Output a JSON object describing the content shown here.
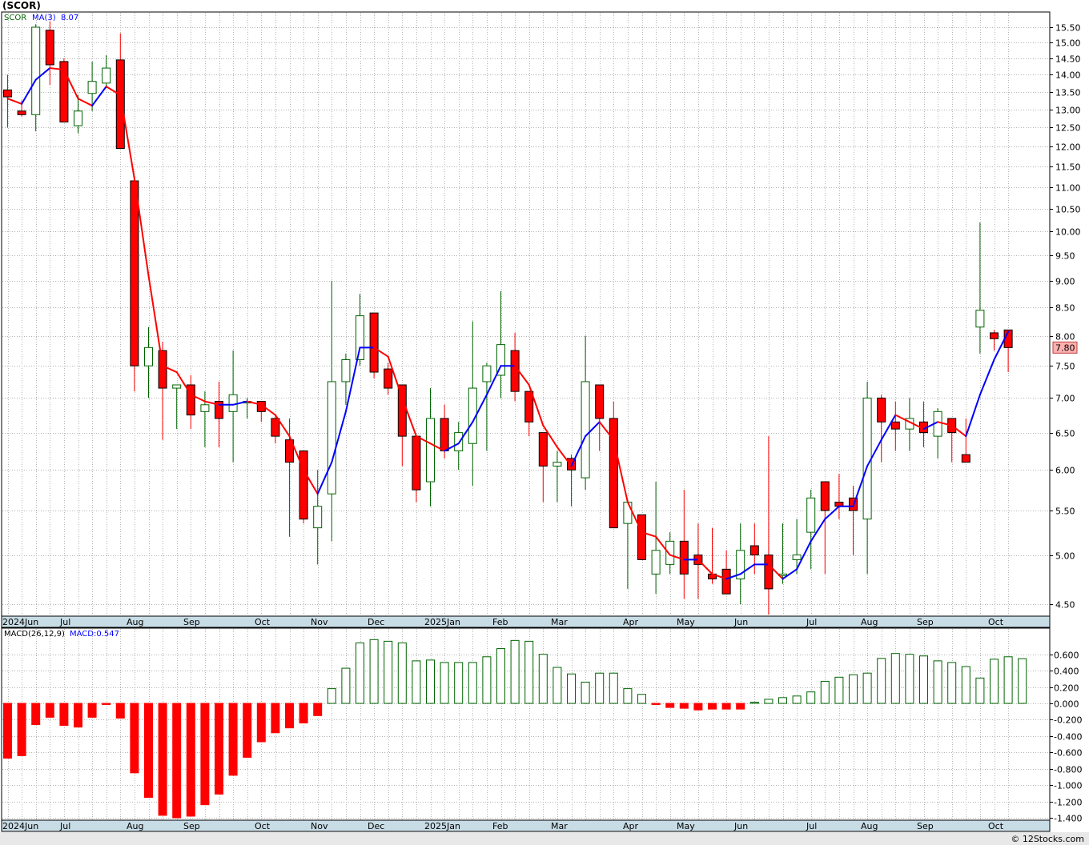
{
  "symbol_label": "(SCOR)",
  "credit": "© 12Stocks.com",
  "colors": {
    "up": "#006400",
    "down": "#ff0000",
    "ma_up": "#0000ff",
    "ma_down": "#ff0000",
    "macd_up": "#006400",
    "macd_down": "#ff0000",
    "price_tag_bg": "#ffb0b0"
  },
  "chart_data": [
    {
      "type": "candlestick",
      "legend": {
        "symbol": "SCOR",
        "ma_label": "MA(3)",
        "ma_value": "8.07"
      },
      "y_ticks": [
        "15.50",
        "15.00",
        "14.50",
        "14.00",
        "13.50",
        "13.00",
        "12.50",
        "12.00",
        "11.50",
        "11.00",
        "10.50",
        "10.00",
        "9.50",
        "9.00",
        "8.50",
        "8.00",
        "7.50",
        "7.00",
        "6.50",
        "6.00",
        "5.50",
        "5.00",
        "4.50"
      ],
      "y_scale": "log",
      "last_price_label": "7.80",
      "x_labels": [
        "2024Jun",
        "Jul",
        "Aug",
        "Sep",
        "Oct",
        "Nov",
        "Dec",
        "2025Jan",
        "Feb",
        "Mar",
        "Apr",
        "May",
        "Jun",
        "Jul",
        "Aug",
        "Sep",
        "Oct"
      ],
      "candles": [
        {
          "o": 13.55,
          "h": 14.0,
          "l": 12.5,
          "c": 13.35
        },
        {
          "o": 12.95,
          "h": 13.25,
          "l": 12.8,
          "c": 12.85
        },
        {
          "o": 12.85,
          "h": 15.6,
          "l": 12.4,
          "c": 15.5
        },
        {
          "o": 15.4,
          "h": 15.7,
          "l": 13.7,
          "c": 14.3
        },
        {
          "o": 14.4,
          "h": 14.5,
          "l": 12.7,
          "c": 12.65
        },
        {
          "o": 12.55,
          "h": 13.4,
          "l": 12.35,
          "c": 12.95
        },
        {
          "o": 13.45,
          "h": 14.4,
          "l": 12.95,
          "c": 13.8
        },
        {
          "o": 13.75,
          "h": 14.6,
          "l": 13.6,
          "c": 14.2
        },
        {
          "o": 14.45,
          "h": 15.3,
          "l": 12.0,
          "c": 11.95
        },
        {
          "o": 11.15,
          "h": 11.2,
          "l": 7.1,
          "c": 7.5
        },
        {
          "o": 7.5,
          "h": 8.15,
          "l": 7.0,
          "c": 7.8
        },
        {
          "o": 7.75,
          "h": 7.9,
          "l": 6.4,
          "c": 7.15
        },
        {
          "o": 7.15,
          "h": 7.2,
          "l": 6.55,
          "c": 7.2
        },
        {
          "o": 7.2,
          "h": 7.35,
          "l": 6.55,
          "c": 6.75
        },
        {
          "o": 6.8,
          "h": 7.1,
          "l": 6.3,
          "c": 6.9
        },
        {
          "o": 6.95,
          "h": 7.25,
          "l": 6.3,
          "c": 6.7
        },
        {
          "o": 6.8,
          "h": 7.75,
          "l": 6.1,
          "c": 7.05
        },
        {
          "o": 6.95,
          "h": 7.0,
          "l": 6.7,
          "c": 6.95
        },
        {
          "o": 6.95,
          "h": 6.95,
          "l": 6.65,
          "c": 6.8
        },
        {
          "o": 6.7,
          "h": 6.75,
          "l": 6.35,
          "c": 6.45
        },
        {
          "o": 6.4,
          "h": 6.7,
          "l": 5.2,
          "c": 6.1
        },
        {
          "o": 6.25,
          "h": 6.25,
          "l": 5.35,
          "c": 5.4
        },
        {
          "o": 5.3,
          "h": 6.0,
          "l": 4.9,
          "c": 5.55
        },
        {
          "o": 5.7,
          "h": 9.0,
          "l": 5.15,
          "c": 7.25
        },
        {
          "o": 7.25,
          "h": 7.7,
          "l": 6.9,
          "c": 7.6
        },
        {
          "o": 7.6,
          "h": 8.75,
          "l": 7.5,
          "c": 8.35
        },
        {
          "o": 8.4,
          "h": 8.4,
          "l": 7.3,
          "c": 7.4
        },
        {
          "o": 7.45,
          "h": 7.55,
          "l": 7.05,
          "c": 7.15
        },
        {
          "o": 7.2,
          "h": 7.2,
          "l": 6.05,
          "c": 6.45
        },
        {
          "o": 6.45,
          "h": 6.45,
          "l": 5.6,
          "c": 5.75
        },
        {
          "o": 5.85,
          "h": 7.15,
          "l": 5.55,
          "c": 6.7
        },
        {
          "o": 6.7,
          "h": 6.9,
          "l": 6.15,
          "c": 6.25
        },
        {
          "o": 6.25,
          "h": 6.65,
          "l": 6.0,
          "c": 6.5
        },
        {
          "o": 6.35,
          "h": 8.25,
          "l": 5.8,
          "c": 7.15
        },
        {
          "o": 7.25,
          "h": 7.55,
          "l": 6.25,
          "c": 7.5
        },
        {
          "o": 7.35,
          "h": 8.8,
          "l": 7.0,
          "c": 7.85
        },
        {
          "o": 7.75,
          "h": 8.05,
          "l": 6.95,
          "c": 7.1
        },
        {
          "o": 7.1,
          "h": 7.1,
          "l": 6.45,
          "c": 6.65
        },
        {
          "o": 6.5,
          "h": 6.5,
          "l": 5.6,
          "c": 6.05
        },
        {
          "o": 6.05,
          "h": 6.25,
          "l": 5.6,
          "c": 6.1
        },
        {
          "o": 6.15,
          "h": 6.2,
          "l": 5.55,
          "c": 6.0
        },
        {
          "o": 5.9,
          "h": 8.0,
          "l": 5.75,
          "c": 7.25
        },
        {
          "o": 7.2,
          "h": 7.2,
          "l": 6.25,
          "c": 6.7
        },
        {
          "o": 6.7,
          "h": 6.95,
          "l": 5.3,
          "c": 5.3
        },
        {
          "o": 5.35,
          "h": 5.55,
          "l": 4.65,
          "c": 5.6
        },
        {
          "o": 5.45,
          "h": 5.45,
          "l": 4.95,
          "c": 4.95
        },
        {
          "o": 4.8,
          "h": 5.85,
          "l": 4.6,
          "c": 5.05
        },
        {
          "o": 4.9,
          "h": 5.25,
          "l": 4.8,
          "c": 5.15
        },
        {
          "o": 5.15,
          "h": 5.75,
          "l": 4.55,
          "c": 4.8
        },
        {
          "o": 5.0,
          "h": 5.35,
          "l": 4.55,
          "c": 4.9
        },
        {
          "o": 4.8,
          "h": 5.3,
          "l": 4.7,
          "c": 4.75
        },
        {
          "o": 4.85,
          "h": 5.05,
          "l": 4.6,
          "c": 4.6
        },
        {
          "o": 4.75,
          "h": 5.35,
          "l": 4.5,
          "c": 5.05
        },
        {
          "o": 5.1,
          "h": 5.35,
          "l": 4.8,
          "c": 5.0
        },
        {
          "o": 5.0,
          "h": 6.45,
          "l": 4.4,
          "c": 4.65
        },
        {
          "o": 4.8,
          "h": 5.35,
          "l": 4.7,
          "c": 4.8
        },
        {
          "o": 4.95,
          "h": 5.4,
          "l": 4.8,
          "c": 5.0
        },
        {
          "o": 5.25,
          "h": 5.75,
          "l": 4.85,
          "c": 5.65
        },
        {
          "o": 5.85,
          "h": 5.85,
          "l": 4.8,
          "c": 5.5
        },
        {
          "o": 5.6,
          "h": 5.95,
          "l": 5.4,
          "c": 5.55
        },
        {
          "o": 5.65,
          "h": 5.8,
          "l": 5.0,
          "c": 5.5
        },
        {
          "o": 5.4,
          "h": 7.25,
          "l": 4.8,
          "c": 7.0
        },
        {
          "o": 7.0,
          "h": 7.05,
          "l": 6.1,
          "c": 6.65
        },
        {
          "o": 6.65,
          "h": 6.95,
          "l": 6.25,
          "c": 6.55
        },
        {
          "o": 6.55,
          "h": 7.0,
          "l": 6.25,
          "c": 6.7
        },
        {
          "o": 6.65,
          "h": 6.95,
          "l": 6.3,
          "c": 6.5
        },
        {
          "o": 6.45,
          "h": 6.85,
          "l": 6.15,
          "c": 6.8
        },
        {
          "o": 6.7,
          "h": 6.7,
          "l": 6.1,
          "c": 6.5
        },
        {
          "o": 6.2,
          "h": 6.7,
          "l": 6.1,
          "c": 6.1
        },
        {
          "o": 8.15,
          "h": 10.2,
          "l": 7.7,
          "c": 8.45
        },
        {
          "o": 8.05,
          "h": 8.1,
          "l": 7.75,
          "c": 7.95
        },
        {
          "o": 8.1,
          "h": 8.1,
          "l": 7.4,
          "c": 7.8
        }
      ],
      "ma3": [
        13.3,
        13.15,
        13.85,
        14.2,
        14.15,
        13.3,
        13.1,
        13.65,
        13.4,
        11.2,
        9.1,
        7.5,
        7.4,
        7.05,
        6.95,
        6.9,
        6.9,
        6.95,
        6.9,
        6.75,
        6.45,
        6.0,
        5.7,
        6.1,
        6.8,
        7.8,
        7.8,
        7.65,
        7.0,
        6.45,
        6.35,
        6.25,
        6.35,
        6.65,
        7.05,
        7.5,
        7.5,
        7.2,
        6.6,
        6.3,
        6.05,
        6.45,
        6.65,
        6.4,
        5.6,
        5.25,
        5.2,
        5.0,
        4.95,
        4.95,
        4.8,
        4.75,
        4.8,
        4.9,
        4.9,
        4.75,
        4.85,
        5.15,
        5.4,
        5.55,
        5.55,
        6.05,
        6.4,
        6.75,
        6.65,
        6.55,
        6.65,
        6.6,
        6.45,
        7.05,
        7.6,
        8.07
      ],
      "x": [
        "2024Jun",
        "",
        "",
        "",
        "Jul",
        "",
        "",
        "",
        "Aug",
        "",
        "",
        "",
        "Sep",
        "",
        "",
        "",
        "",
        "Oct",
        "",
        "",
        "",
        "Nov",
        "",
        "",
        "",
        "Dec",
        "",
        "",
        "",
        "",
        "2025Jan",
        "",
        "",
        "",
        "Feb",
        "",
        "",
        "",
        "Mar",
        "",
        "",
        "",
        "",
        "Apr",
        "",
        "",
        "",
        "May",
        "",
        "",
        "",
        "Jun",
        "",
        "",
        "",
        "",
        "Jul",
        "",
        "",
        "",
        "Aug",
        "",
        "",
        "",
        "Sep",
        "",
        "",
        "",
        "",
        "Oct",
        "",
        "",
        "",
        ""
      ]
    },
    {
      "type": "bar",
      "legend": {
        "label": "MACD(26,12,9)",
        "value_label": "MACD:0.547"
      },
      "y_ticks": [
        "0.600",
        "0.400",
        "0.200",
        "0.000",
        "-0.200",
        "-0.400",
        "-0.600",
        "-0.800",
        "-1.000",
        "-1.200",
        "-1.400"
      ],
      "ylim": [
        -1.4,
        0.75
      ],
      "x_labels": [
        "2024Jun",
        "Jul",
        "Aug",
        "Sep",
        "Oct",
        "Nov",
        "Dec",
        "2025Jan",
        "Feb",
        "Mar",
        "Apr",
        "May",
        "Jun",
        "Jul",
        "Aug",
        "Sep",
        "Oct"
      ],
      "values": [
        -0.67,
        -0.64,
        -0.26,
        -0.17,
        -0.27,
        -0.29,
        -0.17,
        -0.01,
        -0.18,
        -0.85,
        -1.15,
        -1.37,
        -1.4,
        -1.38,
        -1.24,
        -1.11,
        -0.88,
        -0.66,
        -0.47,
        -0.36,
        -0.3,
        -0.24,
        -0.15,
        0.18,
        0.43,
        0.74,
        0.78,
        0.76,
        0.74,
        0.52,
        0.53,
        0.5,
        0.5,
        0.5,
        0.57,
        0.67,
        0.77,
        0.76,
        0.6,
        0.44,
        0.36,
        0.26,
        0.37,
        0.37,
        0.18,
        0.11,
        -0.01,
        -0.05,
        -0.06,
        -0.08,
        -0.07,
        -0.07,
        -0.07,
        0.01,
        0.05,
        0.07,
        0.09,
        0.14,
        0.27,
        0.32,
        0.35,
        0.37,
        0.55,
        0.61,
        0.6,
        0.58,
        0.52,
        0.5,
        0.45,
        0.31,
        0.54,
        0.57,
        0.547
      ]
    }
  ]
}
